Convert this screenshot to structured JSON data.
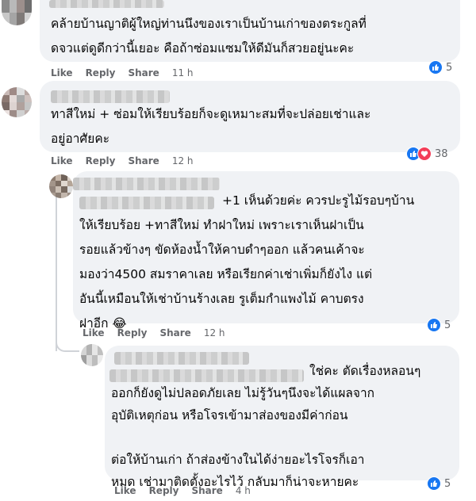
{
  "comments": [
    {
      "text": "คล้ายบ้านญาติผู้ใหญ่ท่านนึงของเราเป็นบ้านเก่าของตระกูลที่\nดจวแต่ดูดีกว่านี้เยอะ คือถ้าซ่อมแซมให้ดีมันก็สวยอยู่นะคะ",
      "like": "Like",
      "reply": "Reply",
      "share": "Share",
      "time": "11 h",
      "reaction_count": "5"
    },
    {
      "text": "ทาสีใหม่ + ซ่อมให้เรียบร้อยก็จะดูเหมาะสมที่จะปล่อยเช่าและ\nอยู่อาศัยคะ",
      "like": "Like",
      "reply": "Reply",
      "share": "Share",
      "time": "12 h",
      "reaction_count": "38"
    },
    {
      "text": "+1 เห็นด้วยค่ะ ควรปะรูไม้รอบๆบ้าน\nให้เรียบร้อย +ทาสีใหม่ ทำฝาใหม่ เพราะเราเห็นฝาเป็น\nรอยแล้วข้างๆ ขัดห้องน้ำให้คาบดำๆออก แล้วคนเค้าจะ\nมองว่า4500 สมราคาเลย หรือเรียกค่าเช่าเพิ่มก็ยังไง แต่\nอันนี้เหมือนให้เช่าบ้านร้างเลย รูเต็มกำแพงไม้ คาบตรง\nฝาอีก 😂",
      "like": "Like",
      "reply": "Reply",
      "share": "Share",
      "time": "12 h",
      "reaction_count": "5"
    },
    {
      "text": "ใช่คะ ตัดเรื่องหลอนๆ\nออกก็ยังดูไม่ปลอดภัยเลย ไม่รู้วันๆนึงจะได้แผลจาก\nอุบัติเหตุก่อน หรือโจรเข้ามาส่องของมีค่าก่อน\n\nต่อให้บ้านเก่า ถ้าส่องข้างในได้ง่ายอะไรโจรก็เอา\nหมด เช่ามาติดตั้งอะไรไว้ กลับมาก็น่าจะหายคะ",
      "like": "Like",
      "reply": "Reply",
      "share": "Share",
      "time": "4 h",
      "reaction_count": "5"
    }
  ],
  "icons": {
    "like": "like-icon",
    "love": "heart-icon"
  },
  "colors": {
    "bubble": "#f0f2f5",
    "meta": "#65676b",
    "like": "#1877f2",
    "love": "#f33e58",
    "thread": "#d0d3d8"
  }
}
